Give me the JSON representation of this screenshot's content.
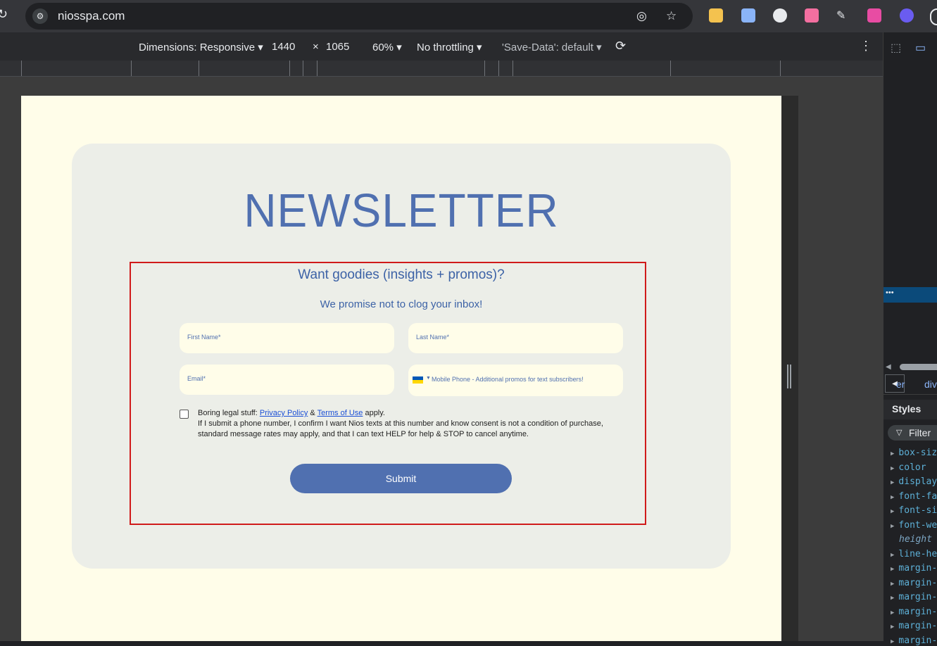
{
  "browser": {
    "url": "niosspa.com",
    "reload_icon": "reload-icon",
    "site_info_icon": "site-info-icon"
  },
  "devtools": {
    "dimensions_label": "Dimensions: Responsive",
    "width": "1440",
    "times": "×",
    "height": "1065",
    "zoom": "60%",
    "throttling": "No throttling",
    "save_data": "'Save-Data': default",
    "breadcrumb_a": "er",
    "breadcrumb_b": "div",
    "styles_tab": "Styles",
    "filter_placeholder": "Filter",
    "css_properties": [
      "box-siz",
      "color",
      "display",
      "font-fa",
      "font-si",
      "font-we",
      "height",
      "line-he",
      "margin-",
      "margin-",
      "margin-",
      "margin-",
      "margin-",
      "margin-"
    ]
  },
  "page": {
    "headline": "NEWSLETTER",
    "subtitle": "Want goodies (insights + promos)?",
    "tagline": "We promise not to clog your inbox!",
    "fields": {
      "first_name": "First Name*",
      "last_name": "Last Name*",
      "email": "Email*",
      "phone": "Mobile Phone - Additional promos for text subscribers!"
    },
    "legal": {
      "prefix": "Boring legal stuff:",
      "privacy": "Privacy Policy",
      "amp": "&",
      "terms": "Terms of Use",
      "suffix": "apply.",
      "body": "If I submit a phone number, I confirm I want Nios texts at this number and know consent is not a condition of purchase, standard message rates may apply, and that I can text HELP for help & STOP to cancel anytime."
    },
    "submit": "Submit"
  },
  "colors": {
    "accent": "#5070b0",
    "page_bg": "#fffde9",
    "card_bg": "#eceee8",
    "highlight": "#d01a1a"
  }
}
